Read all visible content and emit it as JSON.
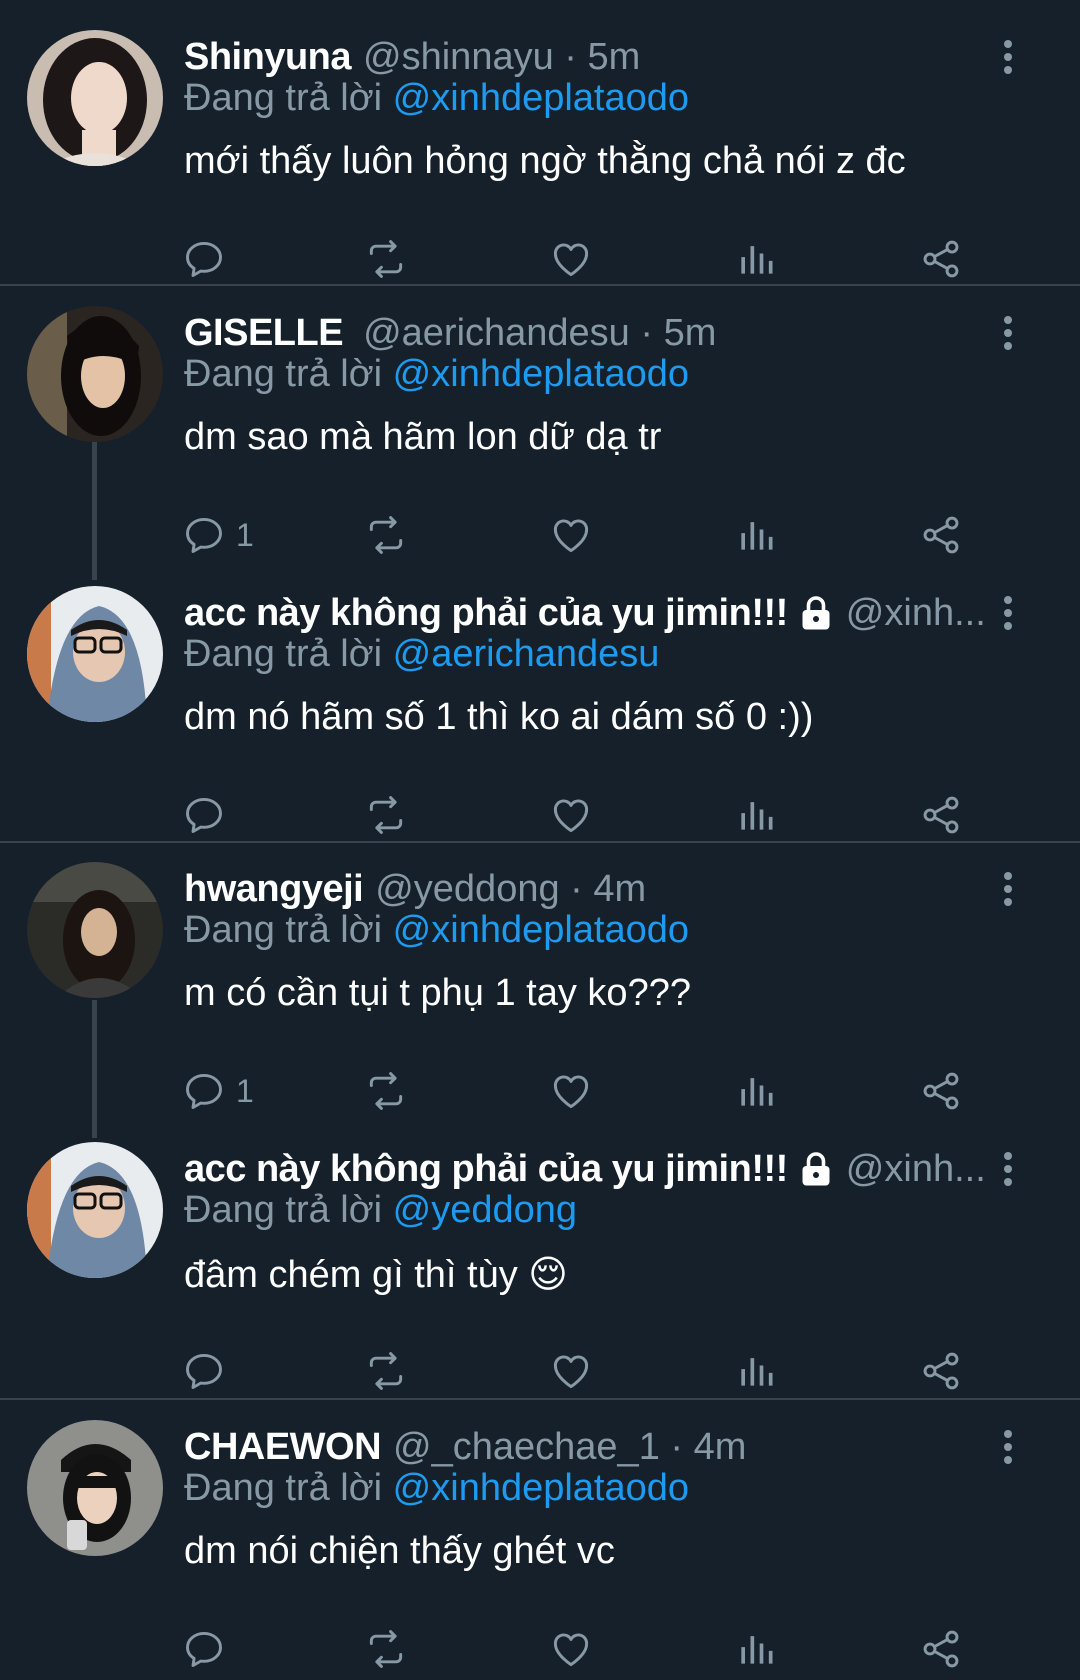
{
  "reply_prefix": "Đang trả lời",
  "tweets": [
    {
      "name": "Shinyuna",
      "handle": "@shinnayu · 5m",
      "reply_to": "@xinhdeplataodo",
      "text": "mới thấy luôn hỏng ngờ thằng chả nói z đc",
      "reply_count": "",
      "avatar_icon": "user-avatar-photo"
    },
    {
      "name": "GISELLE",
      "handle": "@aerichandesu · 5m",
      "reply_to": "@xinhdeplataodo",
      "text": "dm sao mà hãm lon dữ dạ tr",
      "reply_count": "1",
      "avatar_icon": "user-avatar-photo"
    },
    {
      "name": "acc này không phải của yu jimin!!!",
      "handle": "@xinh...",
      "reply_to": "@aerichandesu",
      "text": "dm nó hãm số 1 thì ko ai dám số 0 :))",
      "reply_count": "",
      "locked": true,
      "avatar_icon": "user-avatar-photo"
    },
    {
      "name": "hwangyeji",
      "handle": "@yeddong · 4m",
      "reply_to": "@xinhdeplataodo",
      "text": "m có cần tụi t phụ 1 tay ko???",
      "reply_count": "1",
      "avatar_icon": "user-avatar-photo"
    },
    {
      "name": "acc này không phải của yu jimin!!!",
      "handle": "@xinh...",
      "reply_to": "@yeddong",
      "text": "đâm chém gì thì tùy 😌",
      "reply_count": "",
      "locked": true,
      "avatar_icon": "user-avatar-photo"
    },
    {
      "name": "CHAEWON",
      "handle": "@_chaechae_1 · 4m",
      "reply_to": "@xinhdeplataodo",
      "text": "dm nói chiện thấy ghét vc",
      "reply_count": "",
      "avatar_icon": "user-avatar-photo"
    }
  ],
  "colors": {
    "background": "#15202b",
    "muted": "#8899a6",
    "accent": "#1d9bf0",
    "divider": "#38444d"
  },
  "icons": [
    "reply-icon",
    "retweet-icon",
    "like-icon",
    "analytics-icon",
    "share-icon",
    "more-options-icon",
    "lock-icon"
  ]
}
